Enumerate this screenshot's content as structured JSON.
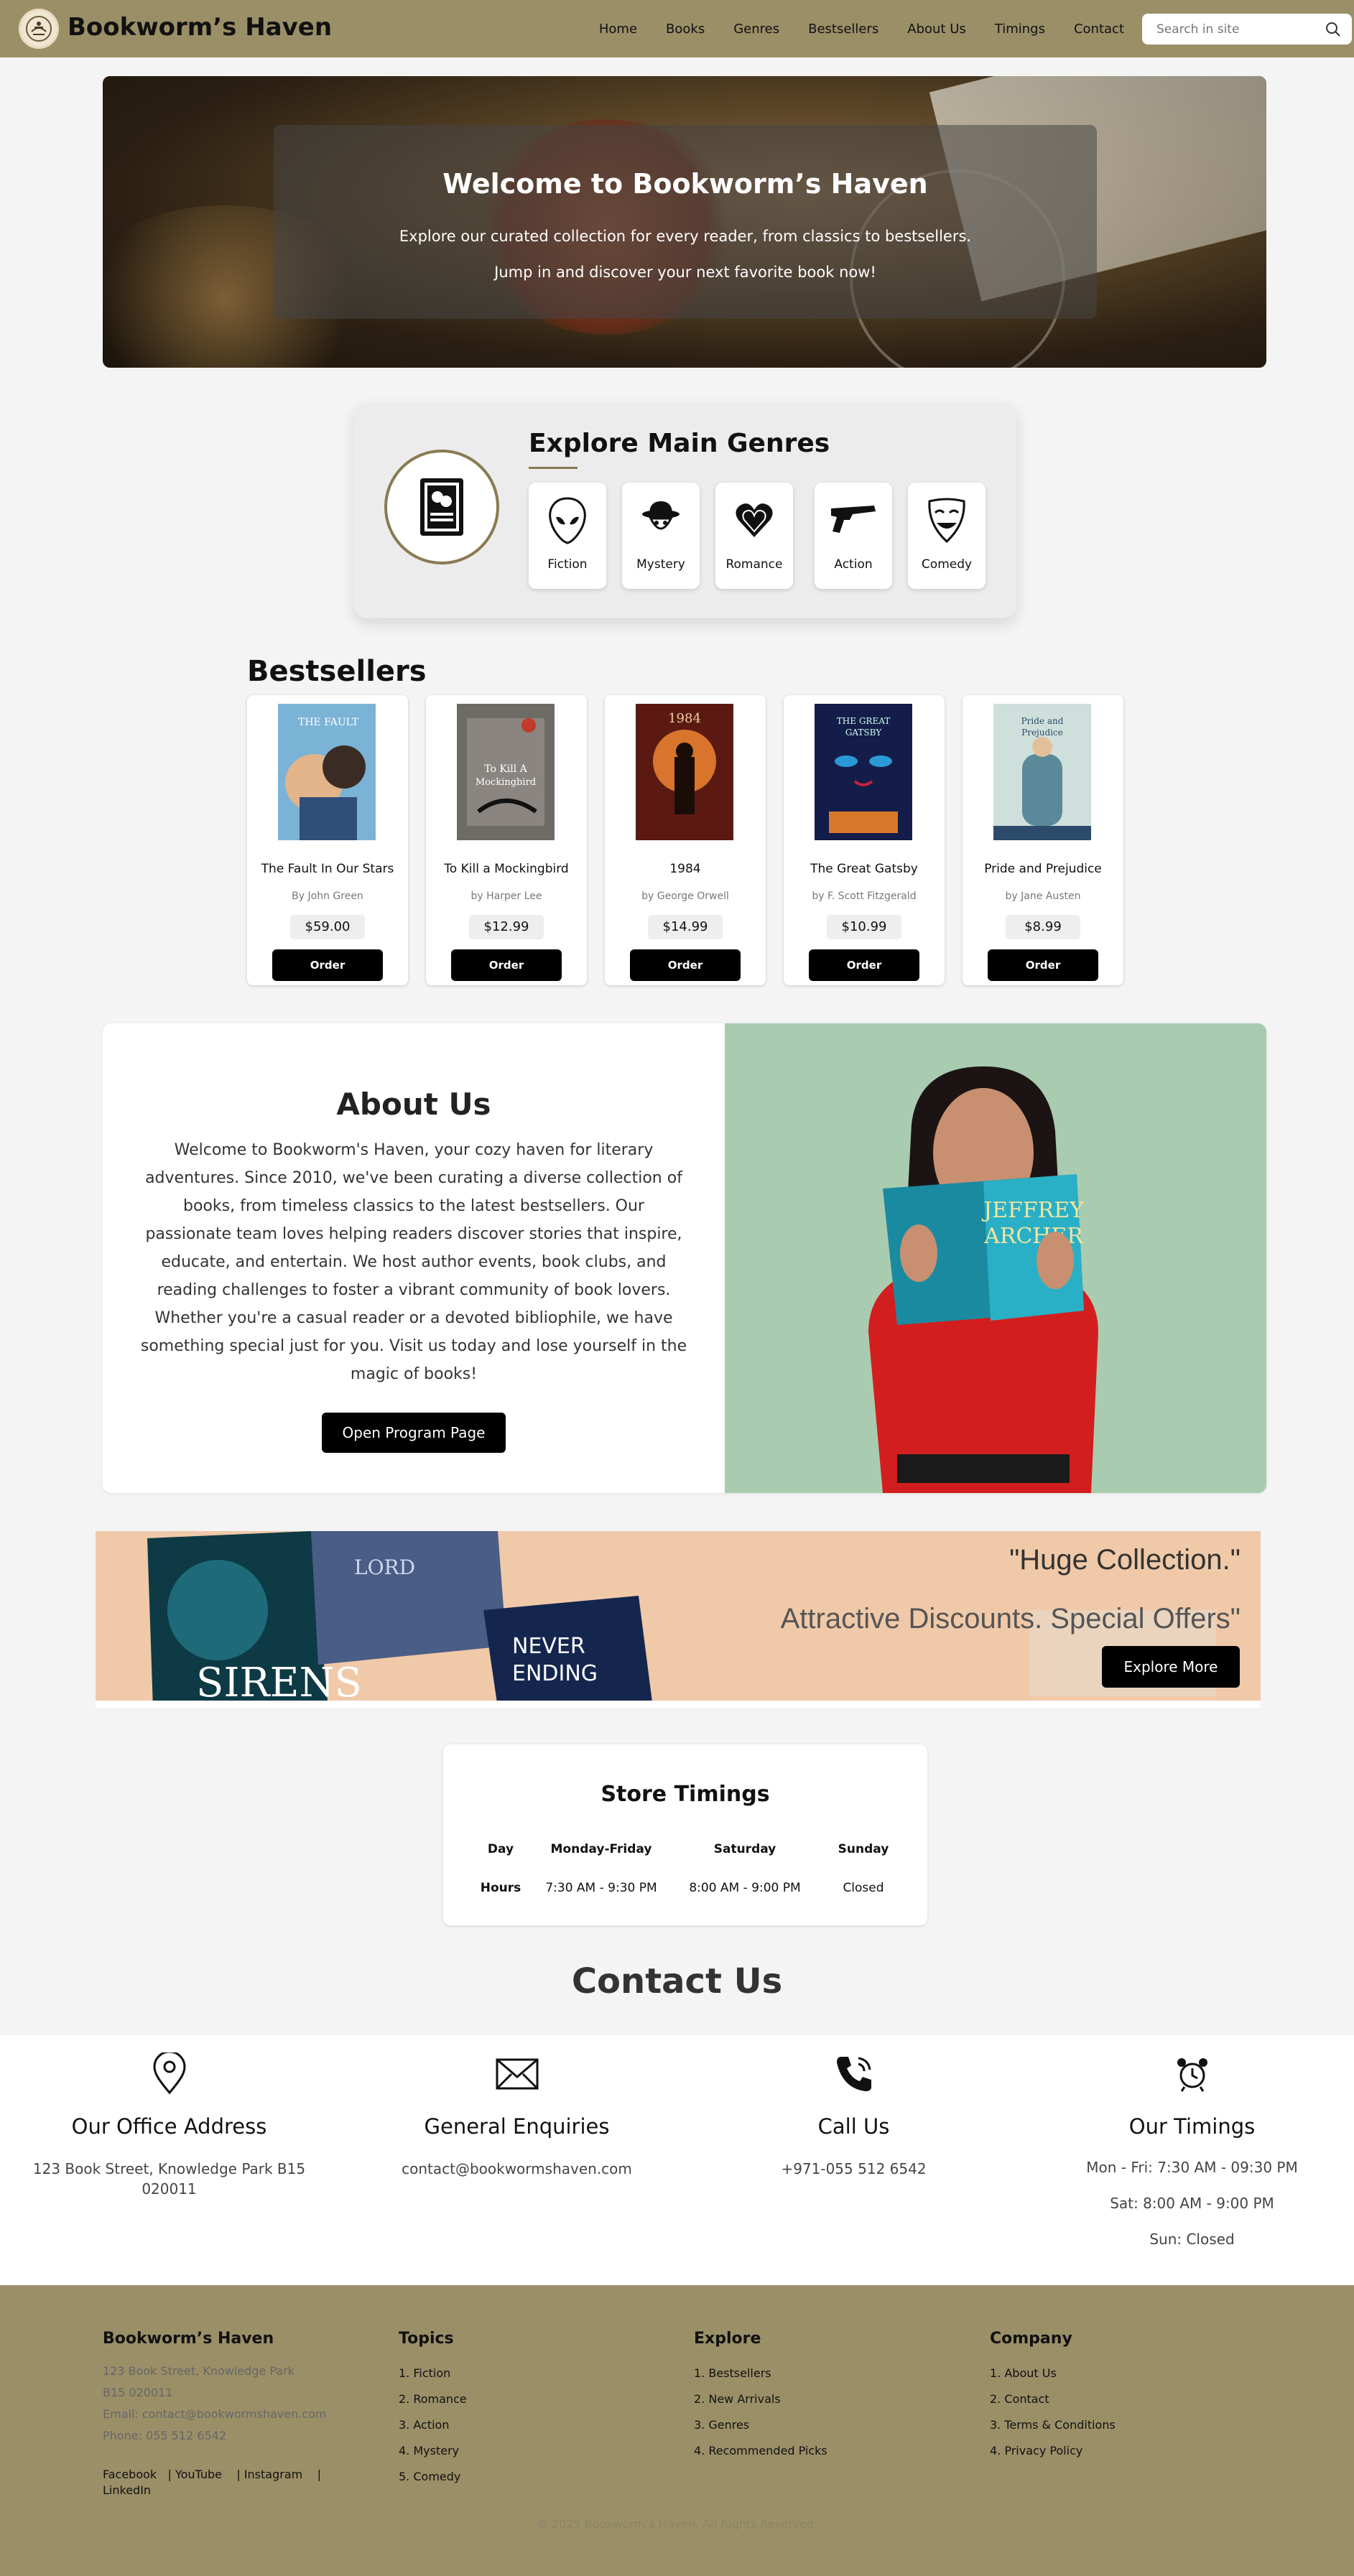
{
  "colors": {
    "nav_bg": "#9b8f68",
    "accent": "#8a7a52",
    "button": "#000000"
  },
  "header": {
    "brand": "Bookworm’s Haven",
    "nav": [
      "Home",
      "Books",
      "Genres",
      "Bestsellers",
      "About Us",
      "Timings",
      "Contact"
    ],
    "search_placeholder": "Search in site"
  },
  "hero": {
    "title": "Welcome to Bookworm’s Haven",
    "line1": "Explore our curated collection for every reader, from classics to bestsellers.",
    "line2": "Jump in and discover your next favorite book now!"
  },
  "genres": {
    "title": "Explore Main Genres",
    "items": [
      {
        "label": "Fiction",
        "icon": "alien-icon"
      },
      {
        "label": "Mystery",
        "icon": "detective-icon"
      },
      {
        "label": "Romance",
        "icon": "heart-icon"
      },
      {
        "label": "Action",
        "icon": "revolver-icon"
      },
      {
        "label": "Comedy",
        "icon": "smiling-mask-icon"
      }
    ]
  },
  "bestsellers": {
    "title": "Bestsellers",
    "books": [
      {
        "title": "The Fault In Our Stars",
        "author": "By John Green",
        "price": "$59.00",
        "order": "Order"
      },
      {
        "title": "To Kill a Mockingbird",
        "author": "by Harper Lee",
        "price": "$12.99",
        "order": "Order"
      },
      {
        "title": "1984",
        "author": "by George Orwell",
        "price": "$14.99",
        "order": "Order"
      },
      {
        "title": "The Great Gatsby",
        "author": "by F. Scott Fitzgerald",
        "price": "$10.99",
        "order": "Order"
      },
      {
        "title": "Pride and Prejudice",
        "author": "by Jane Austen",
        "price": "$8.99",
        "order": "Order"
      }
    ]
  },
  "about": {
    "title": "About Us",
    "text": "Welcome to Bookworm's Haven, your cozy haven for literary adventures. Since 2010, we've been curating a diverse collection of books, from timeless classics to the latest bestsellers. Our passionate team loves helping readers discover stories that inspire, educate, and entertain. We host author events, book clubs, and reading challenges to foster a vibrant community of book lovers. Whether you're a casual reader or a devoted bibliophile, we have something special just for you. Visit us today and lose yourself in the magic of books!",
    "button": "Open Program Page"
  },
  "promo": {
    "quote": "\"Huge Collection.\"",
    "subtitle": "Attractive Discounts. Special Offers\"",
    "button": "Explore More"
  },
  "timings": {
    "title": "Store Timings",
    "row_day": [
      "Day",
      "Monday-Friday",
      "Saturday",
      "Sunday"
    ],
    "row_hours": [
      "Hours",
      "7:30 AM - 9:30 PM",
      "8:00 AM - 9:00 PM",
      "Closed"
    ]
  },
  "contact": {
    "title": "Contact Us",
    "office": {
      "heading": "Our Office Address",
      "value": "123 Book Street, Knowledge Park B15 020011"
    },
    "enquiries": {
      "heading": "General Enquiries",
      "value": "contact@bookwormshaven.com"
    },
    "call": {
      "heading": "Call Us",
      "value": "+971-055 512 6542"
    },
    "hours": {
      "heading": "Our Timings",
      "lines": [
        "Mon - Fri: 7:30 AM - 09:30 PM",
        "Sat: 8:00 AM - 9:00 PM",
        "Sun: Closed"
      ]
    }
  },
  "footer": {
    "brand": "Bookworm’s Haven",
    "address": [
      "123 Book Street, Knowledge Park",
      "B15 020011",
      "Email: contact@bookwormshaven.com",
      "Phone: 055 512 6542"
    ],
    "social": [
      "Facebook",
      "YouTube",
      "Instagram",
      "LinkedIn"
    ],
    "topics": {
      "heading": "Topics",
      "items": [
        "1. Fiction",
        "2. Romance",
        "3. Action",
        "4. Mystery",
        "5. Comedy"
      ]
    },
    "explore": {
      "heading": "Explore",
      "items": [
        "1. Bestsellers",
        "2. New Arrivals",
        "3. Genres",
        "4. Recommended Picks"
      ]
    },
    "company": {
      "heading": "Company",
      "items": [
        "1. About Us",
        "2. Contact",
        "3. Terms & Conditions",
        "4. Privacy Policy"
      ]
    },
    "copyright": "© 2025 Bookworm’s Haven. All Rights Reserved."
  }
}
